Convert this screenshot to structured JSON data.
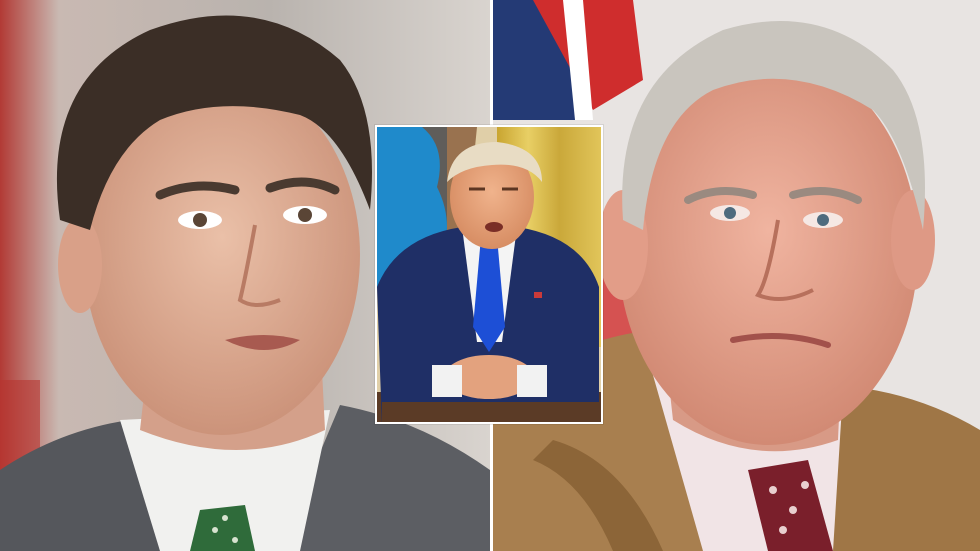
{
  "image": {
    "layout": "collage",
    "panels": [
      {
        "id": "left",
        "subject": "man-in-grey-suit-green-tie"
      },
      {
        "id": "right",
        "subject": "older-man-in-camel-coat-red-paisley-tie"
      },
      {
        "id": "inset",
        "subject": "man-in-navy-suit-blue-tie-at-desk"
      }
    ]
  },
  "colors": {
    "divider": "#ffffff",
    "left_bg": "#b8b1ac",
    "right_bg": "#e8e4e2",
    "skin_left": "#e2b39c",
    "skin_right": "#e6a793",
    "skin_inset": "#e8a27c",
    "grey_suit": "#5c5e63",
    "camel_coat": "#a87f4f",
    "navy_suit": "#1f2f66",
    "blue_tie": "#1d4fd6",
    "green_tie": "#2f6b3a",
    "red_tie": "#7a1f2b",
    "gold_curtain": "#d4b33c"
  }
}
